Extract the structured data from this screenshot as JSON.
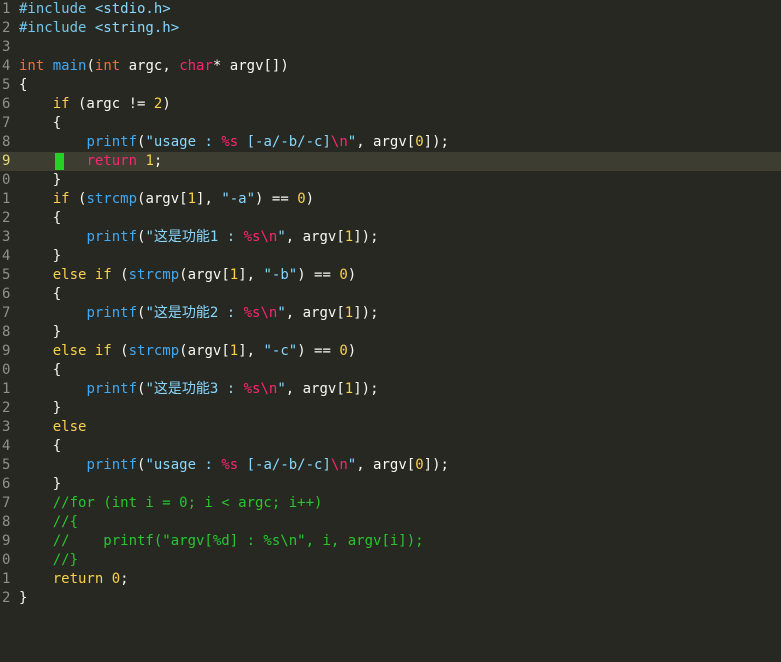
{
  "editor": {
    "cursor_line": 9,
    "lines": [
      {
        "n": "1",
        "tokens": [
          {
            "c": "tok-pp",
            "t": "#include "
          },
          {
            "c": "tok-str2",
            "t": "<stdio.h>"
          }
        ]
      },
      {
        "n": "2",
        "tokens": [
          {
            "c": "tok-pp",
            "t": "#include "
          },
          {
            "c": "tok-str2",
            "t": "<string.h>"
          }
        ]
      },
      {
        "n": "3",
        "tokens": []
      },
      {
        "n": "4",
        "tokens": [
          {
            "c": "tok-type",
            "t": "int"
          },
          {
            "c": "tok-plain",
            "t": " "
          },
          {
            "c": "tok-fn",
            "t": "main"
          },
          {
            "c": "tok-plain",
            "t": "("
          },
          {
            "c": "tok-type",
            "t": "int"
          },
          {
            "c": "tok-plain",
            "t": " argc, "
          },
          {
            "c": "tok-ctype",
            "t": "char"
          },
          {
            "c": "tok-plain",
            "t": "* argv[])"
          }
        ]
      },
      {
        "n": "5",
        "tokens": [
          {
            "c": "tok-plain",
            "t": "{"
          }
        ]
      },
      {
        "n": "6",
        "tokens": [
          {
            "c": "tok-plain",
            "t": "    "
          },
          {
            "c": "tok-kw",
            "t": "if"
          },
          {
            "c": "tok-plain",
            "t": " (argc != "
          },
          {
            "c": "tok-num",
            "t": "2"
          },
          {
            "c": "tok-plain",
            "t": ")"
          }
        ]
      },
      {
        "n": "7",
        "tokens": [
          {
            "c": "tok-plain",
            "t": "    {"
          }
        ]
      },
      {
        "n": "8",
        "tokens": [
          {
            "c": "tok-plain",
            "t": "        "
          },
          {
            "c": "tok-call",
            "t": "printf"
          },
          {
            "c": "tok-plain",
            "t": "("
          },
          {
            "c": "tok-str2",
            "t": "\"usage : "
          },
          {
            "c": "tok-fmt",
            "t": "%s"
          },
          {
            "c": "tok-str2",
            "t": " [-a/-b/-c]"
          },
          {
            "c": "tok-esc",
            "t": "\\n"
          },
          {
            "c": "tok-str2",
            "t": "\""
          },
          {
            "c": "tok-plain",
            "t": ", argv["
          },
          {
            "c": "tok-num",
            "t": "0"
          },
          {
            "c": "tok-plain",
            "t": "]);"
          }
        ]
      },
      {
        "n": "9",
        "tokens": [
          {
            "c": "tok-plain",
            "t": "        "
          },
          {
            "c": "tok-ret",
            "t": "return"
          },
          {
            "c": "tok-plain",
            "t": " "
          },
          {
            "c": "tok-num",
            "t": "1"
          },
          {
            "c": "tok-plain",
            "t": ";"
          }
        ]
      },
      {
        "n": "0",
        "tokens": [
          {
            "c": "tok-plain",
            "t": "    }"
          }
        ]
      },
      {
        "n": "1",
        "tokens": [
          {
            "c": "tok-plain",
            "t": "    "
          },
          {
            "c": "tok-kw",
            "t": "if"
          },
          {
            "c": "tok-plain",
            "t": " ("
          },
          {
            "c": "tok-call",
            "t": "strcmp"
          },
          {
            "c": "tok-plain",
            "t": "(argv["
          },
          {
            "c": "tok-num",
            "t": "1"
          },
          {
            "c": "tok-plain",
            "t": "], "
          },
          {
            "c": "tok-str2",
            "t": "\"-a\""
          },
          {
            "c": "tok-plain",
            "t": ") == "
          },
          {
            "c": "tok-num",
            "t": "0"
          },
          {
            "c": "tok-plain",
            "t": ")"
          }
        ]
      },
      {
        "n": "2",
        "tokens": [
          {
            "c": "tok-plain",
            "t": "    {"
          }
        ]
      },
      {
        "n": "3",
        "tokens": [
          {
            "c": "tok-plain",
            "t": "        "
          },
          {
            "c": "tok-call",
            "t": "printf"
          },
          {
            "c": "tok-plain",
            "t": "("
          },
          {
            "c": "tok-str2",
            "t": "\"这是功能1 : "
          },
          {
            "c": "tok-fmt",
            "t": "%s"
          },
          {
            "c": "tok-esc",
            "t": "\\n"
          },
          {
            "c": "tok-str2",
            "t": "\""
          },
          {
            "c": "tok-plain",
            "t": ", argv["
          },
          {
            "c": "tok-num",
            "t": "1"
          },
          {
            "c": "tok-plain",
            "t": "]);"
          }
        ]
      },
      {
        "n": "4",
        "tokens": [
          {
            "c": "tok-plain",
            "t": "    }"
          }
        ]
      },
      {
        "n": "5",
        "tokens": [
          {
            "c": "tok-plain",
            "t": "    "
          },
          {
            "c": "tok-kw",
            "t": "else if"
          },
          {
            "c": "tok-plain",
            "t": " ("
          },
          {
            "c": "tok-call",
            "t": "strcmp"
          },
          {
            "c": "tok-plain",
            "t": "(argv["
          },
          {
            "c": "tok-num",
            "t": "1"
          },
          {
            "c": "tok-plain",
            "t": "], "
          },
          {
            "c": "tok-str2",
            "t": "\"-b\""
          },
          {
            "c": "tok-plain",
            "t": ") == "
          },
          {
            "c": "tok-num",
            "t": "0"
          },
          {
            "c": "tok-plain",
            "t": ")"
          }
        ]
      },
      {
        "n": "6",
        "tokens": [
          {
            "c": "tok-plain",
            "t": "    {"
          }
        ]
      },
      {
        "n": "7",
        "tokens": [
          {
            "c": "tok-plain",
            "t": "        "
          },
          {
            "c": "tok-call",
            "t": "printf"
          },
          {
            "c": "tok-plain",
            "t": "("
          },
          {
            "c": "tok-str2",
            "t": "\"这是功能2 : "
          },
          {
            "c": "tok-fmt",
            "t": "%s"
          },
          {
            "c": "tok-esc",
            "t": "\\n"
          },
          {
            "c": "tok-str2",
            "t": "\""
          },
          {
            "c": "tok-plain",
            "t": ", argv["
          },
          {
            "c": "tok-num",
            "t": "1"
          },
          {
            "c": "tok-plain",
            "t": "]);"
          }
        ]
      },
      {
        "n": "8",
        "tokens": [
          {
            "c": "tok-plain",
            "t": "    }"
          }
        ]
      },
      {
        "n": "9",
        "tokens": [
          {
            "c": "tok-plain",
            "t": "    "
          },
          {
            "c": "tok-kw",
            "t": "else if"
          },
          {
            "c": "tok-plain",
            "t": " ("
          },
          {
            "c": "tok-call",
            "t": "strcmp"
          },
          {
            "c": "tok-plain",
            "t": "(argv["
          },
          {
            "c": "tok-num",
            "t": "1"
          },
          {
            "c": "tok-plain",
            "t": "], "
          },
          {
            "c": "tok-str2",
            "t": "\"-c\""
          },
          {
            "c": "tok-plain",
            "t": ") == "
          },
          {
            "c": "tok-num",
            "t": "0"
          },
          {
            "c": "tok-plain",
            "t": ")"
          }
        ]
      },
      {
        "n": "0",
        "tokens": [
          {
            "c": "tok-plain",
            "t": "    {"
          }
        ]
      },
      {
        "n": "1",
        "tokens": [
          {
            "c": "tok-plain",
            "t": "        "
          },
          {
            "c": "tok-call",
            "t": "printf"
          },
          {
            "c": "tok-plain",
            "t": "("
          },
          {
            "c": "tok-str2",
            "t": "\"这是功能3 : "
          },
          {
            "c": "tok-fmt",
            "t": "%s"
          },
          {
            "c": "tok-esc",
            "t": "\\n"
          },
          {
            "c": "tok-str2",
            "t": "\""
          },
          {
            "c": "tok-plain",
            "t": ", argv["
          },
          {
            "c": "tok-num",
            "t": "1"
          },
          {
            "c": "tok-plain",
            "t": "]);"
          }
        ]
      },
      {
        "n": "2",
        "tokens": [
          {
            "c": "tok-plain",
            "t": "    }"
          }
        ]
      },
      {
        "n": "3",
        "tokens": [
          {
            "c": "tok-plain",
            "t": "    "
          },
          {
            "c": "tok-kw",
            "t": "else"
          }
        ]
      },
      {
        "n": "4",
        "tokens": [
          {
            "c": "tok-plain",
            "t": "    {"
          }
        ]
      },
      {
        "n": "5",
        "tokens": [
          {
            "c": "tok-plain",
            "t": "        "
          },
          {
            "c": "tok-call",
            "t": "printf"
          },
          {
            "c": "tok-plain",
            "t": "("
          },
          {
            "c": "tok-str2",
            "t": "\"usage : "
          },
          {
            "c": "tok-fmt",
            "t": "%s"
          },
          {
            "c": "tok-str2",
            "t": " [-a/-b/-c]"
          },
          {
            "c": "tok-esc",
            "t": "\\n"
          },
          {
            "c": "tok-str2",
            "t": "\""
          },
          {
            "c": "tok-plain",
            "t": ", argv["
          },
          {
            "c": "tok-num",
            "t": "0"
          },
          {
            "c": "tok-plain",
            "t": "]);"
          }
        ]
      },
      {
        "n": "6",
        "tokens": [
          {
            "c": "tok-plain",
            "t": "    }"
          }
        ]
      },
      {
        "n": "7",
        "tokens": [
          {
            "c": "tok-plain",
            "t": "    "
          },
          {
            "c": "tok-cmt",
            "t": "//for (int i = 0; i < argc; i++)"
          }
        ]
      },
      {
        "n": "8",
        "tokens": [
          {
            "c": "tok-plain",
            "t": "    "
          },
          {
            "c": "tok-cmt",
            "t": "//{"
          }
        ]
      },
      {
        "n": "9",
        "tokens": [
          {
            "c": "tok-plain",
            "t": "    "
          },
          {
            "c": "tok-cmt",
            "t": "//    printf(\"argv[%d] : %s\\n\", i, argv[i]);"
          }
        ]
      },
      {
        "n": "0",
        "tokens": [
          {
            "c": "tok-plain",
            "t": "    "
          },
          {
            "c": "tok-cmt",
            "t": "//}"
          }
        ]
      },
      {
        "n": "1",
        "tokens": [
          {
            "c": "tok-plain",
            "t": "    "
          },
          {
            "c": "tok-kw",
            "t": "return"
          },
          {
            "c": "tok-plain",
            "t": " "
          },
          {
            "c": "tok-num",
            "t": "0"
          },
          {
            "c": "tok-plain",
            "t": ";"
          }
        ]
      },
      {
        "n": "2",
        "tokens": [
          {
            "c": "tok-plain",
            "t": "}"
          }
        ]
      }
    ]
  }
}
